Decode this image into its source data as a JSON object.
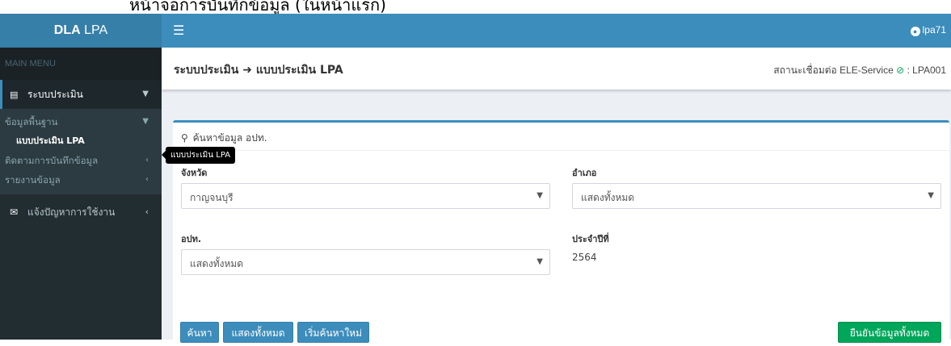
{
  "caption": "หน้าจอการบันทึกข้อมูล (ในหน้าแรก)",
  "brand": {
    "bold": "DLA",
    "rest": " LPA"
  },
  "topbar": {
    "user": "lpa71"
  },
  "sidebar": {
    "menu_header": "MAIN MENU",
    "items": [
      {
        "label": "ระบบประเมิน",
        "icon": "document-icon",
        "expanded": true
      },
      {
        "label": "ข้อมูลพื้นฐาน",
        "expanded": true
      },
      {
        "label": "แบบประเมิน LPA",
        "current": true
      },
      {
        "label": "ติดตามการบันทึกข้อมูล"
      },
      {
        "label": "รายงานข้อมูล"
      },
      {
        "label": "แจ้งปัญหาการใช้งาน",
        "icon": "envelope-icon"
      }
    ]
  },
  "tooltip": "แบบประเมิน LPA",
  "content_header": {
    "title_part1": "ระบบประเมิน",
    "title_part2": "แบบประเมิน LPA",
    "status_label": "สถานะเชื่อมต่อ ELE-Service",
    "status_code": ": LPA001"
  },
  "search_box": {
    "header": "ค้นหาข้อมูล อปท.",
    "fields": {
      "province_label": "จังหวัด",
      "province_value": "กาญจนบุรี",
      "district_label": "อำเภอ",
      "district_value": "แสดงทั้งหมด",
      "org_label": "อปท.",
      "org_value": "แสดงทั้งหมด",
      "year_label": "ประจำปีที่",
      "year_value": "2564"
    },
    "buttons": {
      "search": "ค้นหา",
      "show_all": "แสดงทั้งหมด",
      "reset": "เริ่มค้นหาใหม่",
      "confirm_all": "ยืนยันข้อมูลทั้งหมด"
    }
  },
  "colors": {
    "sidebar": "#222d32",
    "topbar": "#3c8dbc",
    "brand": "#367fa9",
    "accent_green": "#00a65a"
  }
}
